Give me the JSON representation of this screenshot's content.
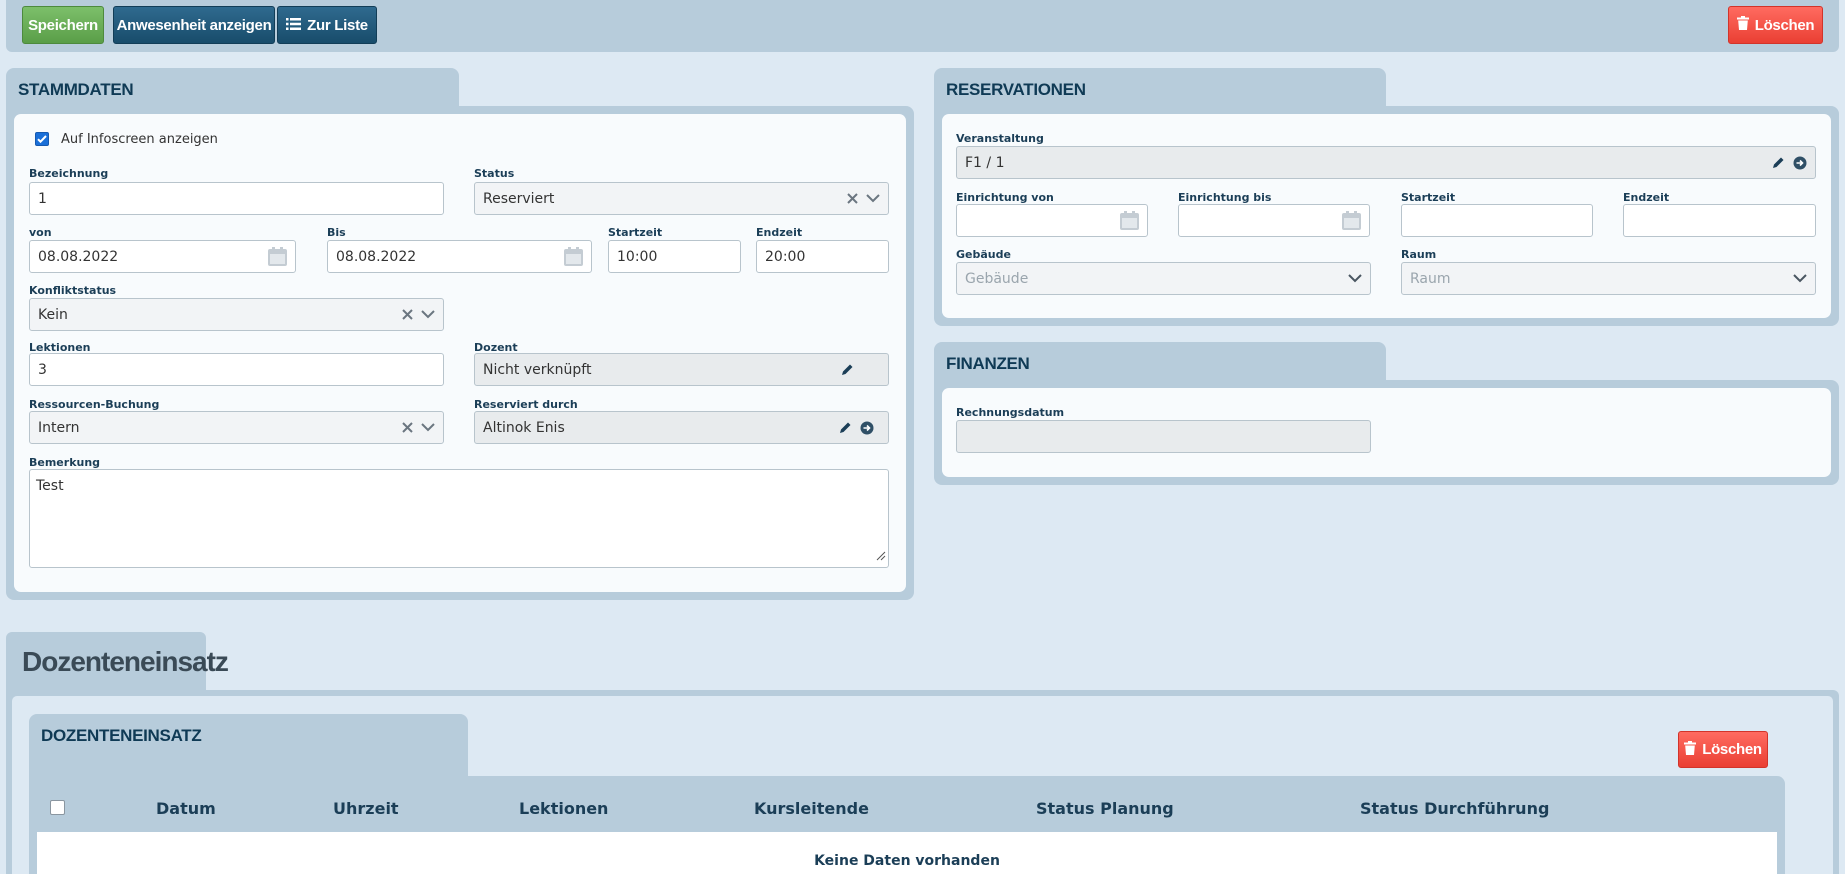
{
  "toolbar": {
    "save": "Speichern",
    "attendance": "Anwesenheit anzeigen",
    "to_list": "Zur Liste",
    "delete": "Löschen"
  },
  "stammdaten": {
    "title": "STAMMDATEN",
    "infoscreen_label": "Auf Infoscreen anzeigen",
    "infoscreen_checked": true,
    "bezeichnung_label": "Bezeichnung",
    "bezeichnung_value": "1",
    "status_label": "Status",
    "status_value": "Reserviert",
    "von_label": "von",
    "von_value": "08.08.2022",
    "bis_label": "Bis",
    "bis_value": "08.08.2022",
    "startzeit_label": "Startzeit",
    "startzeit_value": "10:00",
    "endzeit_label": "Endzeit",
    "endzeit_value": "20:00",
    "konflikt_label": "Konfliktstatus",
    "konflikt_value": "Kein",
    "lektionen_label": "Lektionen",
    "lektionen_value": "3",
    "dozent_label": "Dozent",
    "dozent_value": "Nicht verknüpft",
    "ressourcen_label": "Ressourcen-Buchung",
    "ressourcen_value": "Intern",
    "reserviert_label": "Reserviert durch",
    "reserviert_value": "Altinok Enis",
    "bemerkung_label": "Bemerkung",
    "bemerkung_value": "Test"
  },
  "reservationen": {
    "title": "RESERVATIONEN",
    "veranstaltung_label": "Veranstaltung",
    "veranstaltung_value": "F1 / 1",
    "einr_von_label": "Einrichtung von",
    "einr_bis_label": "Einrichtung bis",
    "startzeit_label": "Startzeit",
    "endzeit_label": "Endzeit",
    "gebaeude_label": "Gebäude",
    "gebaeude_placeholder": "Gebäude",
    "raum_label": "Raum",
    "raum_placeholder": "Raum"
  },
  "finanzen": {
    "title": "FINANZEN",
    "rechnungsdatum_label": "Rechnungsdatum"
  },
  "dozenteneinsatz": {
    "section_title": "Dozenteneinsatz",
    "panel_title": "DOZENTENEINSATZ",
    "delete": "Löschen",
    "columns": [
      "Datum",
      "Uhrzeit",
      "Lektionen",
      "Kursleitende",
      "Status Planung",
      "Status Durchführung"
    ],
    "empty": "Keine Daten vorhanden"
  },
  "colors": {
    "accent_blue": "#1a6fd8",
    "dark_button": "#184c6b",
    "green_button": "#5a9e48",
    "red_button": "#ea3f33"
  }
}
